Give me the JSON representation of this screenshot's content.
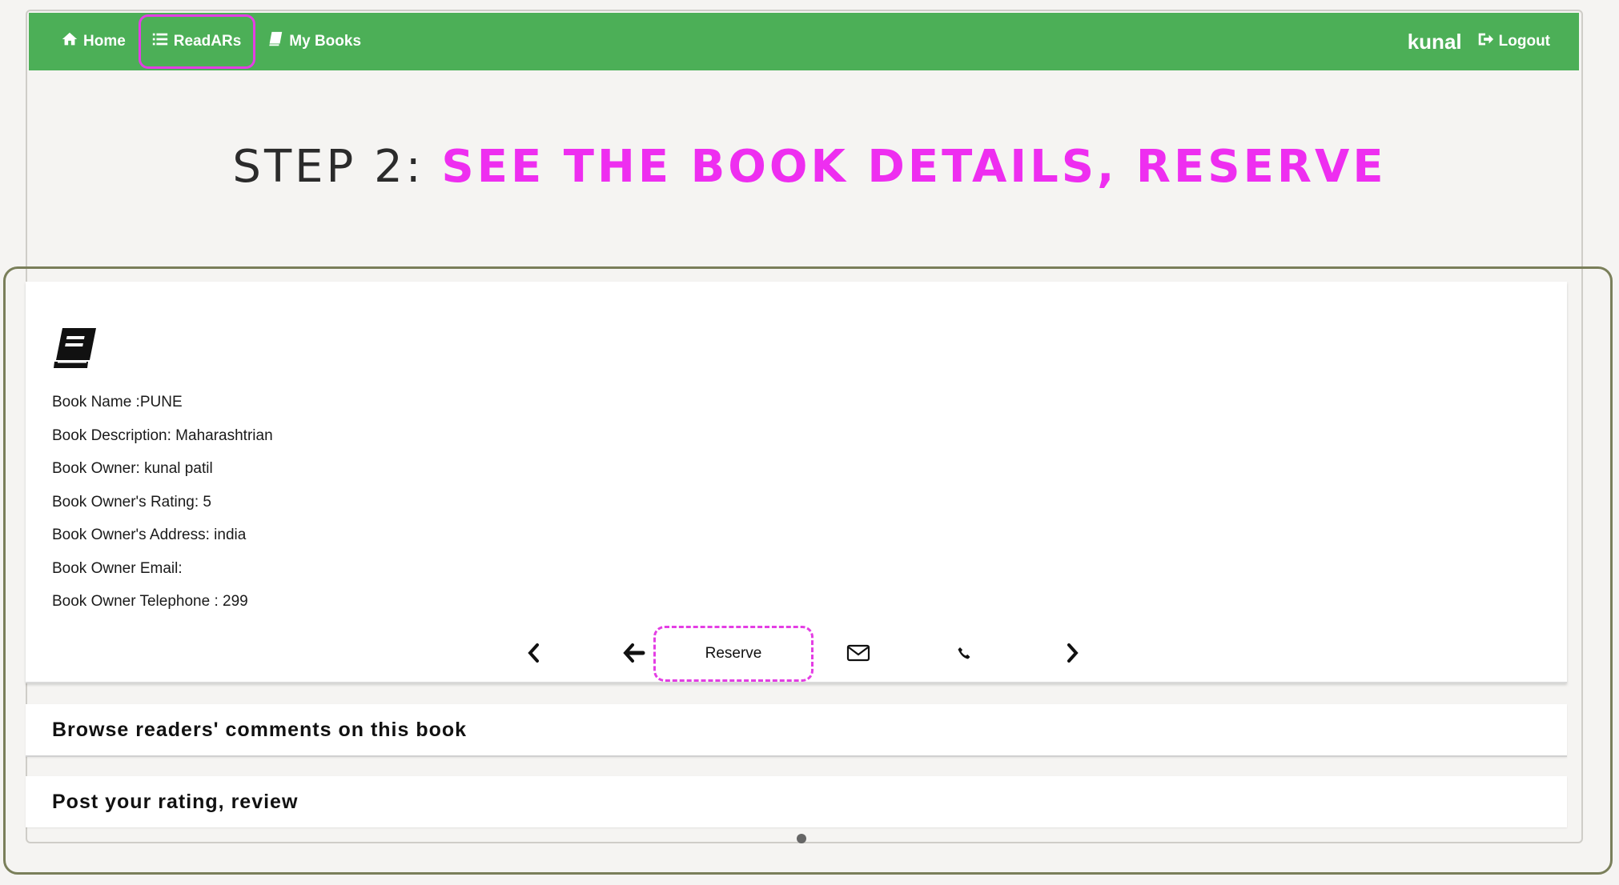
{
  "navbar": {
    "home_label": "Home",
    "readars_label": "ReadARs",
    "mybooks_label": "My Books",
    "user": "kunal",
    "logout_label": "Logout",
    "color": "#4caf57"
  },
  "heading": {
    "step": "STEP 2: ",
    "accent": "SEE THE BOOK DETAILS, RESERVE",
    "accent_color": "#ee2ef0"
  },
  "book": {
    "details": [
      "Book Name :PUNE",
      "Book Description: Maharashtrian",
      "Book Owner: kunal patil",
      "Book Owner's Rating: 5",
      "Book Owner's Address: india",
      "Book Owner Email:",
      "Book Owner Telephone : 299"
    ]
  },
  "actions": {
    "reserve_label": "Reserve",
    "icons": [
      "chevron-left-icon",
      "arrow-left-icon",
      "envelope-icon",
      "phone-icon",
      "chevron-right-icon"
    ]
  },
  "panels": {
    "comments_label": "Browse readers' comments on this book",
    "post_label": "Post your rating, review"
  }
}
